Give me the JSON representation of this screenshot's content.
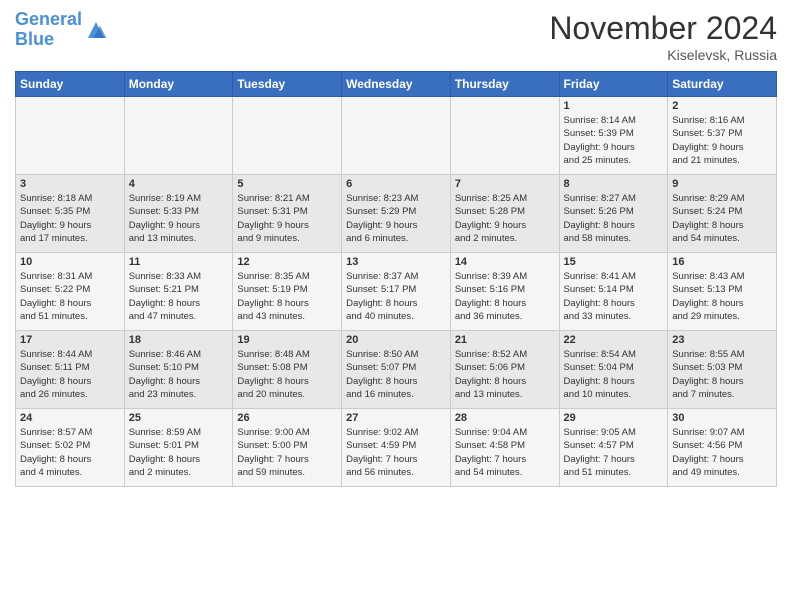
{
  "header": {
    "logo_line1": "General",
    "logo_line2": "Blue",
    "month": "November 2024",
    "location": "Kiselevsk, Russia"
  },
  "weekdays": [
    "Sunday",
    "Monday",
    "Tuesday",
    "Wednesday",
    "Thursday",
    "Friday",
    "Saturday"
  ],
  "weeks": [
    [
      {
        "day": "",
        "info": ""
      },
      {
        "day": "",
        "info": ""
      },
      {
        "day": "",
        "info": ""
      },
      {
        "day": "",
        "info": ""
      },
      {
        "day": "",
        "info": ""
      },
      {
        "day": "1",
        "info": "Sunrise: 8:14 AM\nSunset: 5:39 PM\nDaylight: 9 hours\nand 25 minutes."
      },
      {
        "day": "2",
        "info": "Sunrise: 8:16 AM\nSunset: 5:37 PM\nDaylight: 9 hours\nand 21 minutes."
      }
    ],
    [
      {
        "day": "3",
        "info": "Sunrise: 8:18 AM\nSunset: 5:35 PM\nDaylight: 9 hours\nand 17 minutes."
      },
      {
        "day": "4",
        "info": "Sunrise: 8:19 AM\nSunset: 5:33 PM\nDaylight: 9 hours\nand 13 minutes."
      },
      {
        "day": "5",
        "info": "Sunrise: 8:21 AM\nSunset: 5:31 PM\nDaylight: 9 hours\nand 9 minutes."
      },
      {
        "day": "6",
        "info": "Sunrise: 8:23 AM\nSunset: 5:29 PM\nDaylight: 9 hours\nand 6 minutes."
      },
      {
        "day": "7",
        "info": "Sunrise: 8:25 AM\nSunset: 5:28 PM\nDaylight: 9 hours\nand 2 minutes."
      },
      {
        "day": "8",
        "info": "Sunrise: 8:27 AM\nSunset: 5:26 PM\nDaylight: 8 hours\nand 58 minutes."
      },
      {
        "day": "9",
        "info": "Sunrise: 8:29 AM\nSunset: 5:24 PM\nDaylight: 8 hours\nand 54 minutes."
      }
    ],
    [
      {
        "day": "10",
        "info": "Sunrise: 8:31 AM\nSunset: 5:22 PM\nDaylight: 8 hours\nand 51 minutes."
      },
      {
        "day": "11",
        "info": "Sunrise: 8:33 AM\nSunset: 5:21 PM\nDaylight: 8 hours\nand 47 minutes."
      },
      {
        "day": "12",
        "info": "Sunrise: 8:35 AM\nSunset: 5:19 PM\nDaylight: 8 hours\nand 43 minutes."
      },
      {
        "day": "13",
        "info": "Sunrise: 8:37 AM\nSunset: 5:17 PM\nDaylight: 8 hours\nand 40 minutes."
      },
      {
        "day": "14",
        "info": "Sunrise: 8:39 AM\nSunset: 5:16 PM\nDaylight: 8 hours\nand 36 minutes."
      },
      {
        "day": "15",
        "info": "Sunrise: 8:41 AM\nSunset: 5:14 PM\nDaylight: 8 hours\nand 33 minutes."
      },
      {
        "day": "16",
        "info": "Sunrise: 8:43 AM\nSunset: 5:13 PM\nDaylight: 8 hours\nand 29 minutes."
      }
    ],
    [
      {
        "day": "17",
        "info": "Sunrise: 8:44 AM\nSunset: 5:11 PM\nDaylight: 8 hours\nand 26 minutes."
      },
      {
        "day": "18",
        "info": "Sunrise: 8:46 AM\nSunset: 5:10 PM\nDaylight: 8 hours\nand 23 minutes."
      },
      {
        "day": "19",
        "info": "Sunrise: 8:48 AM\nSunset: 5:08 PM\nDaylight: 8 hours\nand 20 minutes."
      },
      {
        "day": "20",
        "info": "Sunrise: 8:50 AM\nSunset: 5:07 PM\nDaylight: 8 hours\nand 16 minutes."
      },
      {
        "day": "21",
        "info": "Sunrise: 8:52 AM\nSunset: 5:06 PM\nDaylight: 8 hours\nand 13 minutes."
      },
      {
        "day": "22",
        "info": "Sunrise: 8:54 AM\nSunset: 5:04 PM\nDaylight: 8 hours\nand 10 minutes."
      },
      {
        "day": "23",
        "info": "Sunrise: 8:55 AM\nSunset: 5:03 PM\nDaylight: 8 hours\nand 7 minutes."
      }
    ],
    [
      {
        "day": "24",
        "info": "Sunrise: 8:57 AM\nSunset: 5:02 PM\nDaylight: 8 hours\nand 4 minutes."
      },
      {
        "day": "25",
        "info": "Sunrise: 8:59 AM\nSunset: 5:01 PM\nDaylight: 8 hours\nand 2 minutes."
      },
      {
        "day": "26",
        "info": "Sunrise: 9:00 AM\nSunset: 5:00 PM\nDaylight: 7 hours\nand 59 minutes."
      },
      {
        "day": "27",
        "info": "Sunrise: 9:02 AM\nSunset: 4:59 PM\nDaylight: 7 hours\nand 56 minutes."
      },
      {
        "day": "28",
        "info": "Sunrise: 9:04 AM\nSunset: 4:58 PM\nDaylight: 7 hours\nand 54 minutes."
      },
      {
        "day": "29",
        "info": "Sunrise: 9:05 AM\nSunset: 4:57 PM\nDaylight: 7 hours\nand 51 minutes."
      },
      {
        "day": "30",
        "info": "Sunrise: 9:07 AM\nSunset: 4:56 PM\nDaylight: 7 hours\nand 49 minutes."
      }
    ]
  ]
}
